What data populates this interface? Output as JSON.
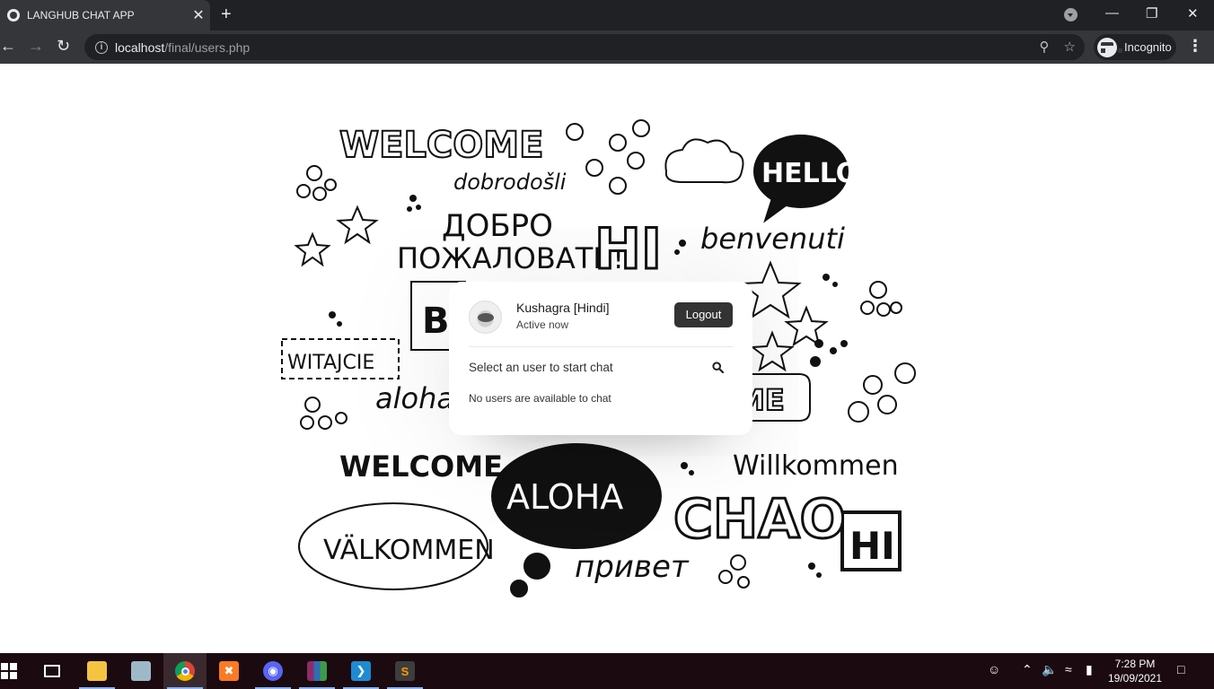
{
  "browser": {
    "tab_title": "LANGHUB CHAT APP",
    "tab_close": "✕",
    "new_tab": "+",
    "url_host": "localhost",
    "url_path": "/final/users.php",
    "profile_label": "Incognito"
  },
  "background_words": [
    "WELCOME",
    "dobrodošli",
    "ДОБРО",
    "ПОЖАЛОВАТЬ!",
    "HI",
    "HELLO",
    "benvenuti",
    "WITAJCIE",
    "BI",
    "aloha",
    "ME",
    "WELCOME",
    "ALOHA",
    "Willkommen",
    "CHAO",
    "HI",
    "VÄLKOMMEN",
    "привет"
  ],
  "chat": {
    "user_name": "Kushagra [Hindi]",
    "user_status": "Active now",
    "logout_label": "Logout",
    "search_prompt": "Select an user to start chat",
    "empty_message": "No users are available to chat"
  },
  "taskbar": {
    "time": "7:28 PM",
    "date": "19/09/2021"
  },
  "colors": {
    "chrome_dark": "#202124",
    "chrome_tab": "#35363a",
    "logout_bg": "#333333",
    "taskbar_bg": "#1b0a10"
  }
}
